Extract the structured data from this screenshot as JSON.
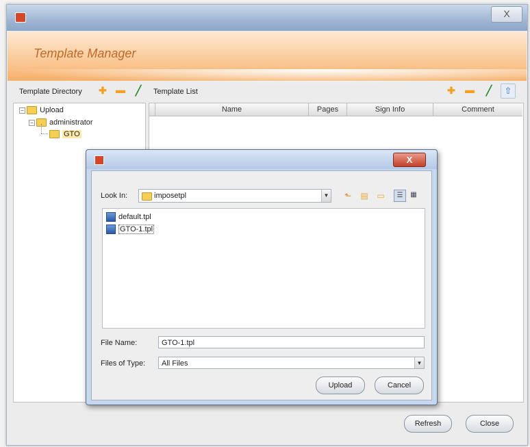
{
  "outer_window": {
    "close_glyph": "X"
  },
  "banner": {
    "title": "Template Manager"
  },
  "directory_panel": {
    "label": "Template Directory",
    "tree": [
      {
        "label": "Upload",
        "expander": "−"
      },
      {
        "label": "administrator",
        "expander": "−"
      },
      {
        "label": "GTO"
      }
    ]
  },
  "template_list": {
    "label": "Template List",
    "columns": [
      "Name",
      "Pages",
      "Sign Info",
      "Comment"
    ]
  },
  "toolbar_icons": {
    "add": "plus-icon",
    "remove": "minus-icon",
    "edit": "pencil-icon",
    "upload": "upload-arrow-icon"
  },
  "footer": {
    "refresh_label": "Refresh",
    "close_label": "Close"
  },
  "upload_dialog": {
    "close_glyph": "X",
    "look_in_label": "Look In:",
    "look_in_value": "imposetpl",
    "files": [
      {
        "name": "default.tpl",
        "selected": false
      },
      {
        "name": "GTO-1.tpl",
        "selected": true
      }
    ],
    "file_name_label": "File Name:",
    "file_name_value": "GTO-1.tpl",
    "files_of_type_label": "Files of Type:",
    "files_of_type_value": "All Files",
    "upload_label": "Upload",
    "cancel_label": "Cancel"
  },
  "colors": {
    "banner_orange": "#f9c38c",
    "banner_title": "#c06a2a",
    "dialog_close_red": "#c5412a",
    "folder_yellow": "#f5cf55"
  }
}
